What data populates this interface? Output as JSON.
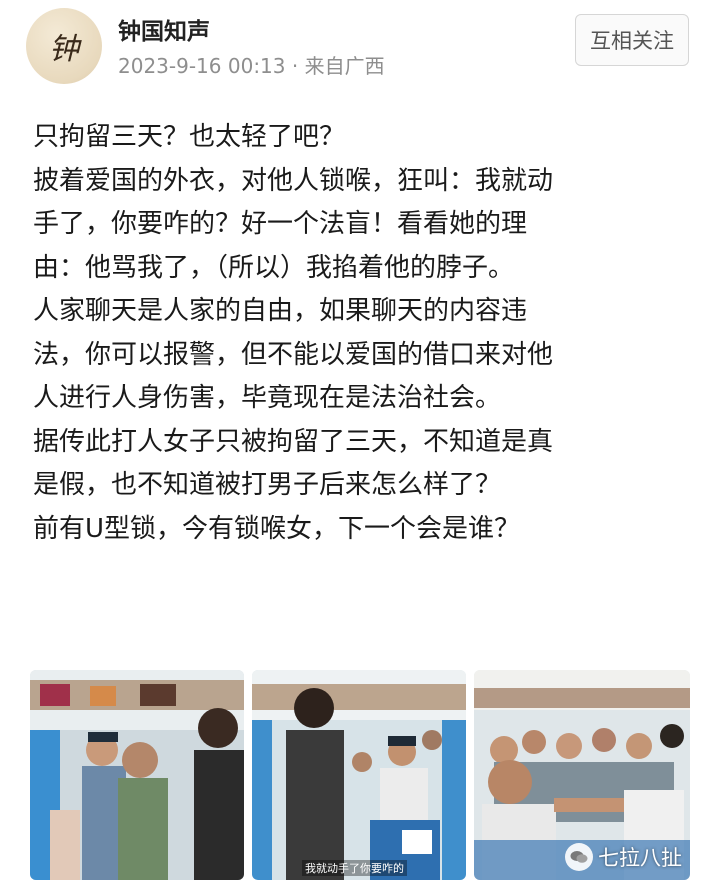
{
  "author": {
    "avatar_char": "钟",
    "name": "钟国知声",
    "timestamp": "2023-9-16 00:13",
    "source": "· 来自广西"
  },
  "follow_button": "互相关注",
  "post_lines": [
    "只拘留三天？也太轻了吧？",
    "披着爱国的外衣，对他人锁喉，狂叫：我就动",
    "手了，你要咋的？好一个法盲！看看她的理",
    "由：他骂我了，（所以）我掐着他的脖子。",
    "人家聊天是人家的自由，如果聊天的内容违",
    "法，你可以报警，但不能以爱国的借口来对他",
    "人进行人身伤害，毕竟现在是法治社会。",
    "据传此打人女子只被拘留了三天，不知道是真",
    "是假，也不知道被打男子后来怎么样了？",
    "前有U型锁，今有锁喉女，下一个会是谁？"
  ],
  "photos": {
    "subtitle_2": "我就动手了你要咋的",
    "watermark": "七拉八扯"
  }
}
